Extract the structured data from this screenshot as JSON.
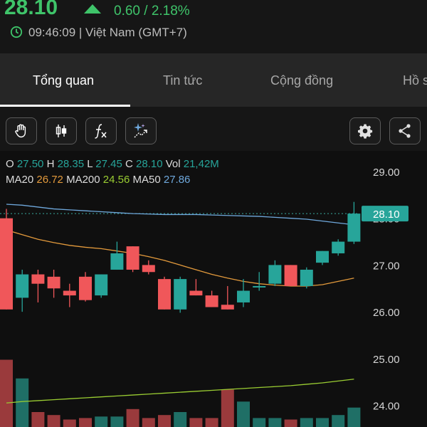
{
  "header": {
    "price": "28.10",
    "change": "0.60 / 2.18%",
    "time": "09:46:09 | Việt Nam (GMT+7)"
  },
  "tabs": [
    {
      "label": "Tổng quan",
      "active": true
    },
    {
      "label": "Tin tức",
      "active": false
    },
    {
      "label": "Cộng đồng",
      "active": false
    },
    {
      "label": "Hồ s",
      "active": false
    }
  ],
  "toolbar": {
    "icons": [
      "hand-icon",
      "candlestick-icon",
      "fx-icon",
      "sparkle-chart-icon",
      "gear-icon",
      "share-icon"
    ]
  },
  "ohlc": {
    "o_label": "O",
    "o": "27.50",
    "h_label": "H",
    "h": "28.35",
    "l_label": "L",
    "l": "27.45",
    "c_label": "C",
    "c": "28.10",
    "vol_label": "Vol",
    "vol": "21,42M"
  },
  "ma": {
    "ma20_label": "MA20",
    "ma20": "26.72",
    "ma200_label": "MA200",
    "ma200": "24.56",
    "ma50_label": "MA50",
    "ma50": "27.86"
  },
  "colors": {
    "up": "#27a59a",
    "down": "#f0575a",
    "accent_green": "#3fc46a",
    "ma20": "#e39a3c",
    "ma50": "#6fa8dc",
    "ma200": "#9acd32"
  },
  "chart_data": {
    "type": "candlestick",
    "y_ticks": [
      "29.00",
      "28.00",
      "27.00",
      "26.00",
      "25.00",
      "24.00"
    ],
    "y_range": [
      23.6,
      29.4
    ],
    "current_price_label": "28.10",
    "current_price": 28.1,
    "candles": [
      {
        "o": 28.0,
        "h": 28.2,
        "l": 26.05,
        "c": 26.05
      },
      {
        "o": 26.3,
        "h": 26.9,
        "l": 26.0,
        "c": 26.8
      },
      {
        "o": 26.8,
        "h": 26.9,
        "l": 26.2,
        "c": 26.6
      },
      {
        "o": 26.75,
        "h": 26.9,
        "l": 26.3,
        "c": 26.5
      },
      {
        "o": 26.45,
        "h": 26.6,
        "l": 26.1,
        "c": 26.35
      },
      {
        "o": 26.75,
        "h": 26.85,
        "l": 26.22,
        "c": 26.25
      },
      {
        "o": 26.35,
        "h": 26.8,
        "l": 26.3,
        "c": 26.8
      },
      {
        "o": 26.9,
        "h": 27.5,
        "l": 26.9,
        "c": 27.25
      },
      {
        "o": 27.4,
        "h": 27.4,
        "l": 26.85,
        "c": 26.9
      },
      {
        "o": 27.0,
        "h": 27.1,
        "l": 26.8,
        "c": 26.85
      },
      {
        "o": 26.7,
        "h": 26.75,
        "l": 26.05,
        "c": 26.05
      },
      {
        "o": 26.05,
        "h": 26.75,
        "l": 25.98,
        "c": 26.7
      },
      {
        "o": 26.45,
        "h": 26.7,
        "l": 26.35,
        "c": 26.35
      },
      {
        "o": 26.35,
        "h": 26.45,
        "l": 26.1,
        "c": 26.1
      },
      {
        "o": 26.15,
        "h": 26.55,
        "l": 26.05,
        "c": 26.05
      },
      {
        "o": 26.2,
        "h": 26.7,
        "l": 26.1,
        "c": 26.45
      },
      {
        "o": 26.55,
        "h": 26.85,
        "l": 26.45,
        "c": 26.55
      },
      {
        "o": 26.6,
        "h": 27.1,
        "l": 26.55,
        "c": 27.0
      },
      {
        "o": 27.0,
        "h": 27.0,
        "l": 26.55,
        "c": 26.55
      },
      {
        "o": 26.55,
        "h": 26.95,
        "l": 26.5,
        "c": 26.9
      },
      {
        "o": 27.05,
        "h": 27.3,
        "l": 27.0,
        "c": 27.3
      },
      {
        "o": 27.25,
        "h": 27.55,
        "l": 27.2,
        "c": 27.5
      },
      {
        "o": 27.5,
        "h": 28.35,
        "l": 27.45,
        "c": 28.1
      }
    ],
    "volumes": [
      9.0,
      6.5,
      2.0,
      1.6,
      1.0,
      1.2,
      1.4,
      1.4,
      2.4,
      1.2,
      1.6,
      2.0,
      1.2,
      1.2,
      5.0,
      3.4,
      1.2,
      1.2,
      1.0,
      1.2,
      1.2,
      1.6,
      2.6
    ],
    "volume_up": [
      false,
      true,
      false,
      false,
      false,
      false,
      true,
      true,
      false,
      false,
      false,
      true,
      false,
      false,
      false,
      true,
      true,
      true,
      false,
      true,
      true,
      true,
      true
    ],
    "ma20_series": [
      27.75,
      27.65,
      27.55,
      27.48,
      27.42,
      27.38,
      27.35,
      27.3,
      27.25,
      27.18,
      27.1,
      27.0,
      26.9,
      26.8,
      26.72,
      26.65,
      26.6,
      26.57,
      26.55,
      26.55,
      26.58,
      26.65,
      26.72
    ],
    "ma50_series": [
      28.3,
      28.28,
      28.24,
      28.2,
      28.18,
      28.16,
      28.14,
      28.12,
      28.1,
      28.09,
      28.08,
      28.08,
      28.08,
      28.07,
      28.06,
      28.05,
      28.04,
      28.02,
      28.0,
      27.98,
      27.94,
      27.9,
      27.86
    ],
    "ma200_series": [
      24.05,
      24.08,
      24.1,
      24.12,
      24.14,
      24.16,
      24.18,
      24.2,
      24.22,
      24.24,
      24.26,
      24.28,
      24.3,
      24.32,
      24.34,
      24.36,
      24.38,
      24.4,
      24.42,
      24.45,
      24.48,
      24.52,
      24.56
    ]
  }
}
